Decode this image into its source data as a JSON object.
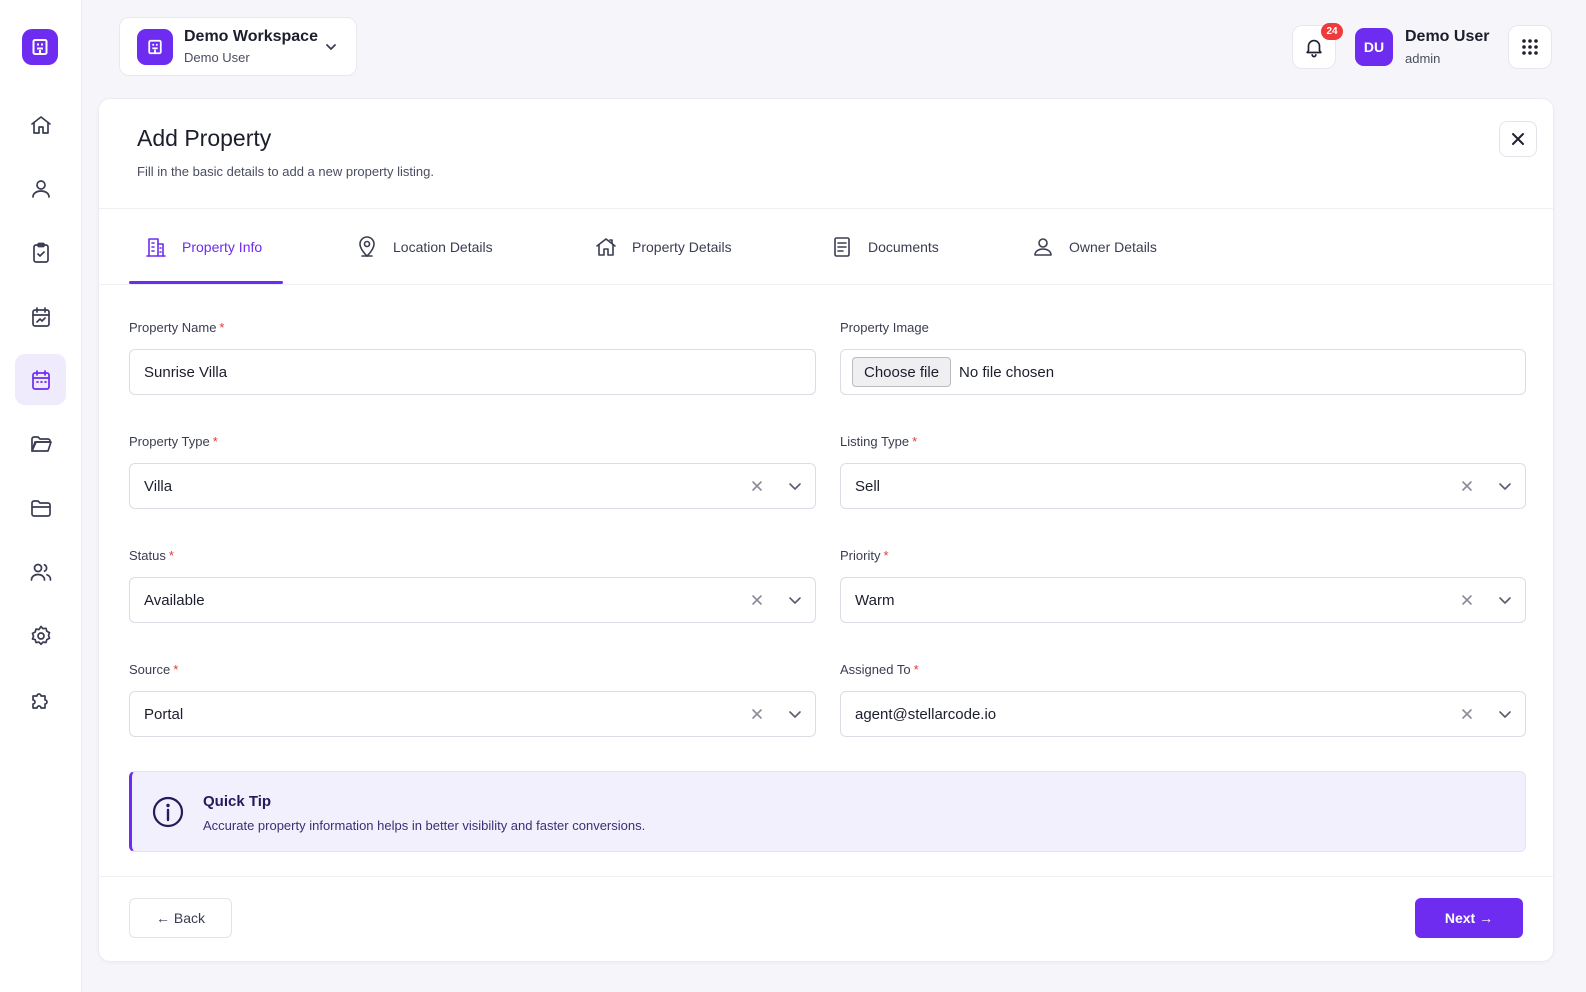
{
  "workspace": {
    "title": "Demo Workspace",
    "subtitle": "Demo User"
  },
  "header": {
    "notification_count": "24",
    "user_initials": "DU",
    "user_name": "Demo User",
    "user_role": "admin"
  },
  "sidebar": {
    "items": [
      {
        "icon": "home-icon"
      },
      {
        "icon": "user-icon"
      },
      {
        "icon": "clipboard-check-icon"
      },
      {
        "icon": "calendar-stats-icon"
      },
      {
        "icon": "calendar-icon",
        "active": true
      },
      {
        "icon": "folder-open-icon"
      },
      {
        "icon": "folder-icon"
      },
      {
        "icon": "users-icon"
      },
      {
        "icon": "gear-icon"
      },
      {
        "icon": "puzzle-icon"
      }
    ]
  },
  "modal": {
    "title": "Add Property",
    "subtitle": "Fill in the basic details to add a new property listing."
  },
  "tabs": [
    {
      "label": "Property Info",
      "icon": "building-icon",
      "active": true
    },
    {
      "label": "Location Details",
      "icon": "map-pin-icon"
    },
    {
      "label": "Property Details",
      "icon": "house-icon"
    },
    {
      "label": "Documents",
      "icon": "document-icon"
    },
    {
      "label": "Owner Details",
      "icon": "user-icon"
    }
  ],
  "form": {
    "property_name": {
      "label": "Property Name",
      "value": "Sunrise Villa"
    },
    "property_image": {
      "label": "Property Image",
      "button": "Choose file",
      "status": "No file chosen"
    },
    "property_type": {
      "label": "Property Type",
      "value": "Villa"
    },
    "listing_type": {
      "label": "Listing Type",
      "value": "Sell"
    },
    "status": {
      "label": "Status",
      "value": "Available"
    },
    "priority": {
      "label": "Priority",
      "value": "Warm"
    },
    "source": {
      "label": "Source",
      "value": "Portal"
    },
    "assigned_to": {
      "label": "Assigned To",
      "value": "agent@stellarcode.io"
    },
    "required_mark": "*"
  },
  "tip": {
    "title": "Quick Tip",
    "text": "Accurate property information helps in better visibility and faster conversions."
  },
  "footer": {
    "back_label": "← Back",
    "next_label": "Next →"
  },
  "colors": {
    "accent": "#6d2cf0",
    "required": "#e53935",
    "badge": "#ef3b3b"
  }
}
